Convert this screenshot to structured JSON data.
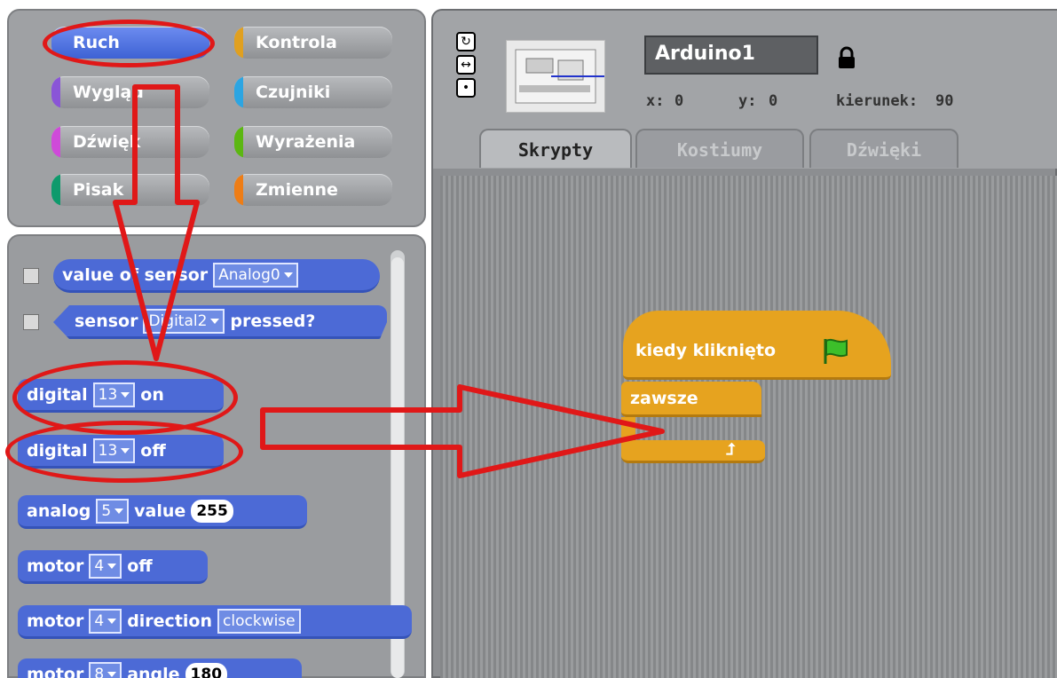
{
  "categories": [
    {
      "label": "Ruch",
      "color": "#4a6cd4",
      "selected": true
    },
    {
      "label": "Kontrola",
      "color": "#e0a020"
    },
    {
      "label": "Wygląd",
      "color": "#8a55d7"
    },
    {
      "label": "Czujniki",
      "color": "#2ca5e2"
    },
    {
      "label": "Dźwięk",
      "color": "#cf4ad9"
    },
    {
      "label": "Wyrażenia",
      "color": "#5cb712"
    },
    {
      "label": "Pisak",
      "color": "#0e9a6c"
    },
    {
      "label": "Zmienne",
      "color": "#ee7d16"
    }
  ],
  "palette": {
    "value_of_sensor": {
      "label": "value of sensor",
      "dropdown": "Analog0"
    },
    "sensor_pressed": {
      "label_a": "sensor",
      "dropdown": "Digital2",
      "label_b": "pressed?"
    },
    "digital_on": {
      "label_a": "digital",
      "dropdown": "13",
      "label_b": "on"
    },
    "digital_off": {
      "label_a": "digital",
      "dropdown": "13",
      "label_b": "off"
    },
    "analog_value": {
      "label_a": "analog",
      "dropdown": "5",
      "label_b": "value",
      "number": "255"
    },
    "motor_off": {
      "label_a": "motor",
      "dropdown": "4",
      "label_b": "off"
    },
    "motor_direction": {
      "label_a": "motor",
      "dropdown": "4",
      "label_b": "direction",
      "dropdown2": "clockwise"
    },
    "motor_angle": {
      "label_a": "motor",
      "dropdown": "8",
      "label_b": "angle",
      "number": "180"
    }
  },
  "sprite": {
    "name": "Arduino1",
    "x_label": "x:",
    "x": "0",
    "y_label": "y:",
    "y": "0",
    "dir_label": "kierunek:",
    "dir": "90"
  },
  "tabs": [
    {
      "label": "Skrypty",
      "active": true
    },
    {
      "label": "Kostiumy"
    },
    {
      "label": "Dźwięki"
    }
  ],
  "script": {
    "hat": "kiedy kliknięto",
    "forever": "zawsze"
  },
  "colors": {
    "motion_block": "#4c6ad6",
    "control_block": "#e6a31f",
    "annotation": "#e01818"
  }
}
